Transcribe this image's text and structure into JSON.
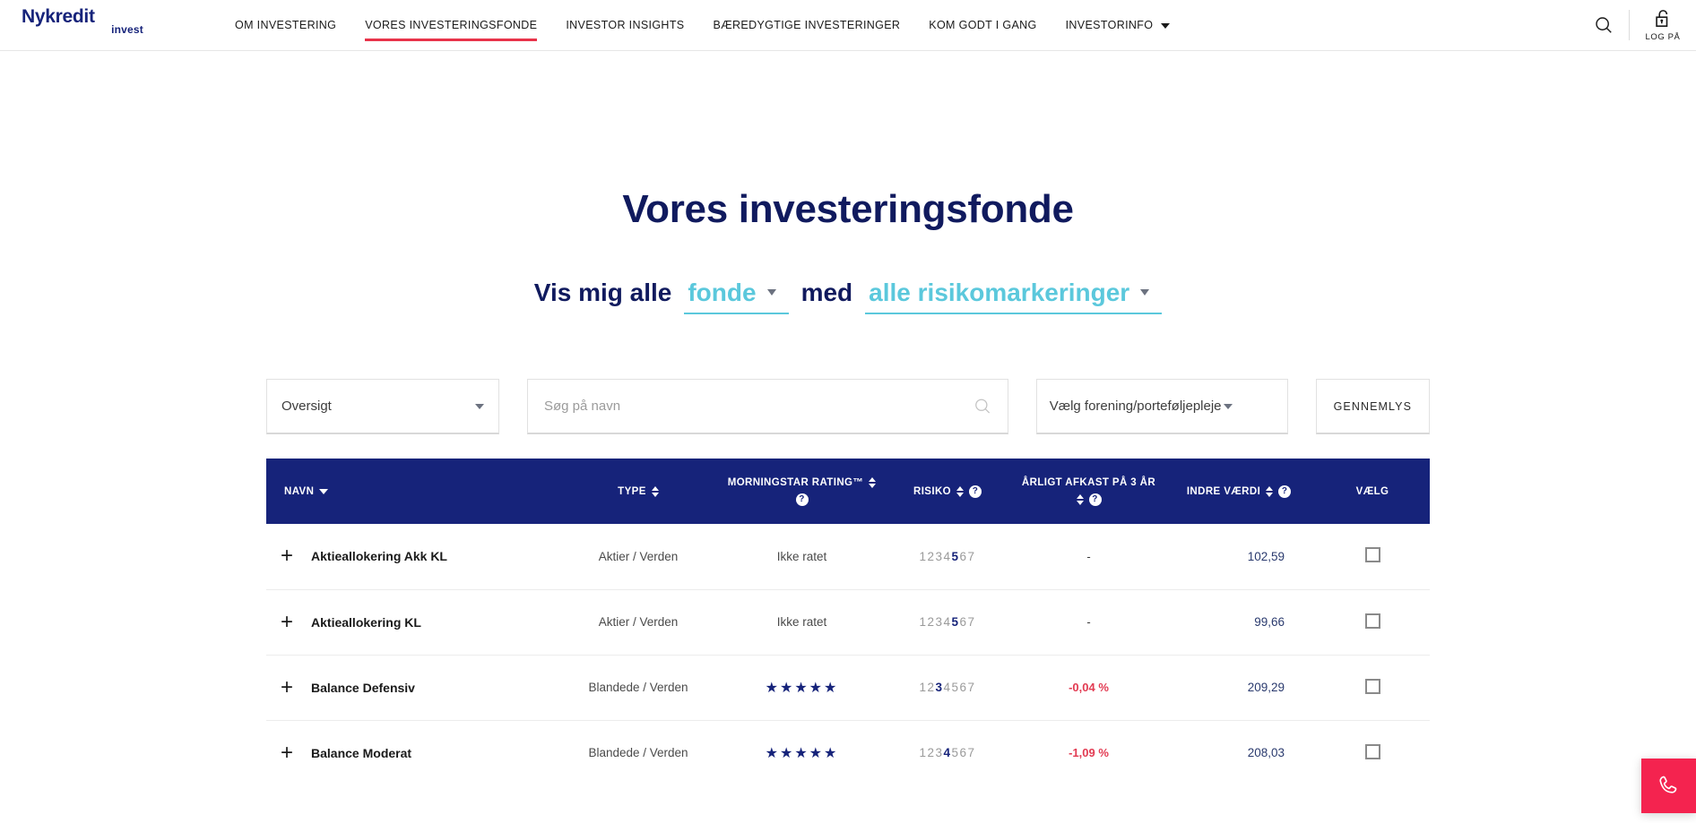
{
  "header": {
    "logo_main": "Nykredit",
    "logo_sub": "invest",
    "nav": [
      {
        "label": "OM INVESTERING",
        "active": false,
        "caret": false
      },
      {
        "label": "VORES INVESTERINGSFONDE",
        "active": true,
        "caret": false
      },
      {
        "label": "INVESTOR INSIGHTS",
        "active": false,
        "caret": false
      },
      {
        "label": "BÆREDYGTIGE INVESTERINGER",
        "active": false,
        "caret": false
      },
      {
        "label": "KOM GODT I GANG",
        "active": false,
        "caret": false
      },
      {
        "label": "INVESTORINFO",
        "active": false,
        "caret": true
      }
    ],
    "search_icon": "search-icon",
    "login_icon": "open-padlock-icon",
    "login_label": "LOG PÅ",
    "active_underline_color": "#e8334a"
  },
  "page": {
    "title": "Vores investeringsfonde",
    "filter_sentence": {
      "part1": "Vis mig alle",
      "dropdown1": "fonde",
      "part2": "med",
      "dropdown2": "alle risikomarkeringer",
      "accent_color": "#5bc8dc"
    }
  },
  "controls": {
    "view_select": "Oversigt",
    "search_placeholder": "Søg på navn",
    "search_value": "",
    "association_select": "Vælg forening/porteføljepleje",
    "gennemlys_button": "GENNEMLYS"
  },
  "table": {
    "header_color": "#16237a",
    "columns": [
      {
        "label": "NAVN",
        "sort": "caret-down",
        "help": false
      },
      {
        "label": "TYPE",
        "sort": "updown",
        "help": false
      },
      {
        "label": "MORNINGSTAR RATING™",
        "sort": "updown",
        "help": true
      },
      {
        "label": "RISIKO",
        "sort": "updown",
        "help": true
      },
      {
        "label": "ÅRLIGT AFKAST PÅ 3 ÅR",
        "sort": "updown",
        "help": true
      },
      {
        "label": "INDRE VÆRDI",
        "sort": "updown",
        "help": true
      },
      {
        "label": "VÆLG",
        "sort": "none",
        "help": false
      }
    ],
    "rows": [
      {
        "expand": "+",
        "name": "Aktieallokering Akk KL",
        "type": "Aktier / Verden",
        "rating_text": "Ikke ratet",
        "stars": 0,
        "risk": 5,
        "return_3y": "-",
        "return_negative": false,
        "nav_value": "102,59",
        "selected": false
      },
      {
        "expand": "+",
        "name": "Aktieallokering KL",
        "type": "Aktier / Verden",
        "rating_text": "Ikke ratet",
        "stars": 0,
        "risk": 5,
        "return_3y": "-",
        "return_negative": false,
        "nav_value": "99,66",
        "selected": false
      },
      {
        "expand": "+",
        "name": "Balance Defensiv",
        "type": "Blandede / Verden",
        "rating_text": "",
        "stars": 5,
        "risk": 3,
        "return_3y": "-0,04 %",
        "return_negative": true,
        "nav_value": "209,29",
        "selected": false
      },
      {
        "expand": "+",
        "name": "Balance Moderat",
        "type": "Blandede / Verden",
        "rating_text": "",
        "stars": 5,
        "risk": 4,
        "return_3y": "-1,09 %",
        "return_negative": true,
        "nav_value": "208,03",
        "selected": false
      }
    ],
    "risk_scale": [
      1,
      2,
      3,
      4,
      5,
      6,
      7
    ]
  },
  "fab": {
    "icon": "phone-icon",
    "color": "#f4234f"
  }
}
